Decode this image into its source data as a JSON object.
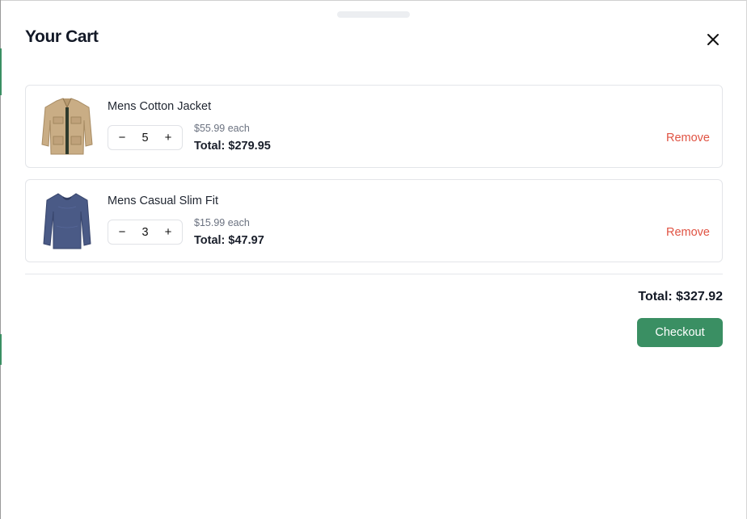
{
  "cart": {
    "title": "Your Cart",
    "close_icon": "close-icon",
    "items": [
      {
        "name": "Mens Cotton Jacket",
        "quantity": "5",
        "unit_price": "$55.99 each",
        "line_total": "Total: $279.95",
        "remove_label": "Remove",
        "decrement_label": "−",
        "increment_label": "+",
        "image": "jacket-image"
      },
      {
        "name": "Mens Casual Slim Fit",
        "quantity": "3",
        "unit_price": "$15.99 each",
        "line_total": "Total: $47.97",
        "remove_label": "Remove",
        "decrement_label": "−",
        "increment_label": "+",
        "image": "shirt-image"
      }
    ],
    "grand_total": "Total: $327.92",
    "checkout_label": "Checkout"
  },
  "colors": {
    "accent": "#3a8f63",
    "danger": "#e05343",
    "muted_text": "#6b7280",
    "border": "#e3e5e9"
  }
}
